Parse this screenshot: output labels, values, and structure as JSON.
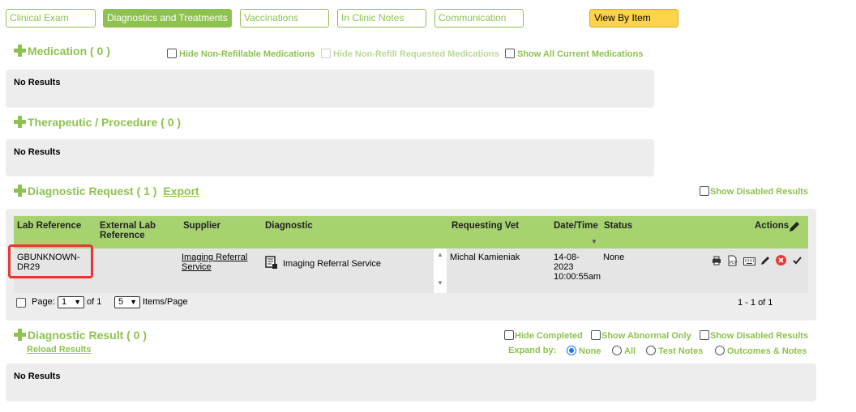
{
  "tabs": [
    {
      "label": "Clinical Exam"
    },
    {
      "label": "Diagnostics and Treatments"
    },
    {
      "label": "Vaccinations"
    },
    {
      "label": "In Clinic Notes"
    },
    {
      "label": "Communication"
    }
  ],
  "view_by_item": "View By Item",
  "medication": {
    "title": "Medication ( 0 )",
    "hide_non_refillable": "Hide Non-Refillable Medications",
    "hide_non_refill_requested": "Hide Non-Refill Requested Medications",
    "show_all_current": "Show All Current Medications",
    "no_results": "No Results"
  },
  "therapeutic": {
    "title": "Therapeutic / Procedure ( 0 )",
    "no_results": "No Results"
  },
  "diagnostic_request": {
    "title": "Diagnostic Request ( 1 )",
    "export": "Export",
    "show_disabled": "Show Disabled Results",
    "columns": {
      "lab_reference": "Lab Reference",
      "external_lab_reference_1": "External Lab",
      "external_lab_reference_2": "Reference",
      "supplier": "Supplier",
      "diagnostic": "Diagnostic",
      "requesting_vet": "Requesting Vet",
      "date_time": "Date/Time",
      "status": "Status",
      "actions": "Actions"
    },
    "row": {
      "lab_reference_1": "GBUNKNOWN-",
      "lab_reference_2": "DR29",
      "supplier_1": "Imaging Referral",
      "supplier_2": "Service",
      "diagnostic": "Imaging Referral Service",
      "requesting_vet": "Michal Kamieniak",
      "date_1": "14-08-",
      "date_2": "2023",
      "date_3": "10:00:55am",
      "status": "None"
    },
    "pager": {
      "page_label": "Page:",
      "page_value": "1",
      "of_label": "of 1",
      "items_value": "5",
      "items_label": "Items/Page",
      "range": "1 - 1 of 1"
    }
  },
  "diagnostic_result": {
    "title": "Diagnostic Result ( 0 )",
    "reload": "Reload Results",
    "hide_completed": "Hide Completed",
    "show_abnormal": "Show Abnormal Only",
    "show_disabled": "Show Disabled Results",
    "expand_by": "Expand by:",
    "expand_options": [
      "None",
      "All",
      "Test Notes",
      "Outcomes & Notes"
    ],
    "expand_selected": "None",
    "no_results": "No Results"
  },
  "colors": {
    "accent_green": "#8dc24f",
    "header_green": "#a6d36f",
    "view_button_yellow": "#fed54a",
    "highlight_red": "#e53935"
  }
}
